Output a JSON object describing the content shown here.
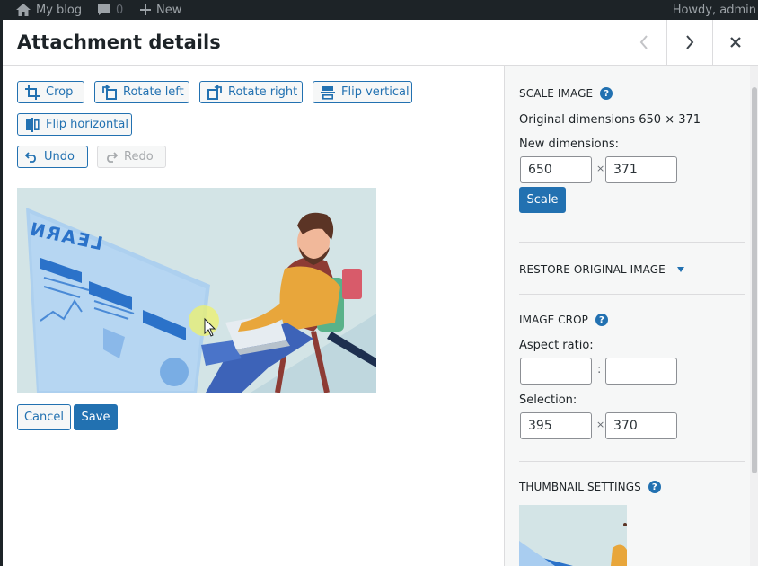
{
  "adminbar": {
    "site": "My blog",
    "comments_count": "0",
    "new_label": "New",
    "howdy": "Howdy, admin"
  },
  "modal": {
    "title": "Attachment details"
  },
  "toolbar": {
    "crop": "Crop",
    "rotate_left": "Rotate left",
    "rotate_right": "Rotate right",
    "flip_vertical": "Flip vertical",
    "flip_horizontal": "Flip horizontal",
    "undo": "Undo",
    "redo": "Redo"
  },
  "actions": {
    "cancel": "Cancel",
    "save": "Save"
  },
  "preview_image": {
    "screen_text": "LEARN"
  },
  "sidebar": {
    "scale": {
      "title": "Scale Image",
      "original": "Original dimensions 650 × 371",
      "new_label": "New dimensions:",
      "width": "650",
      "height": "371",
      "times": "×",
      "button": "Scale"
    },
    "restore": {
      "title": "Restore original image"
    },
    "crop": {
      "title": "Image Crop",
      "aspect_label": "Aspect ratio:",
      "aspect_w": "",
      "aspect_h": "",
      "colon": ":",
      "selection_label": "Selection:",
      "sel_w": "395",
      "sel_h": "370",
      "times": "×"
    },
    "thumbnail": {
      "title": "Thumbnail Settings"
    }
  },
  "colors": {
    "accent": "#2271b1",
    "adminbar": "#1d2327",
    "sidebar_bg": "#f6f7f7"
  }
}
